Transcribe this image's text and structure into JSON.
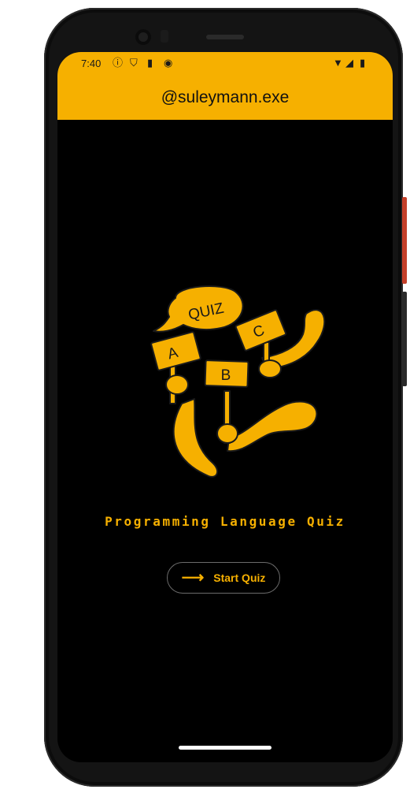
{
  "status_bar": {
    "time": "7:40",
    "left_icons": [
      "info-icon",
      "shield-icon",
      "sim-icon",
      "app-icon"
    ],
    "right_icons": [
      "wifi-icon",
      "signal-icon",
      "battery-icon"
    ]
  },
  "app_bar": {
    "title": "@suleymann.exe"
  },
  "illustration": {
    "bubble_text": "QUIZ",
    "signs": [
      "A",
      "B",
      "C"
    ]
  },
  "main": {
    "title": "Programming Language Quiz",
    "start_button": {
      "label": "Start Quiz",
      "icon": "arrow-right-icon"
    }
  },
  "colors": {
    "accent": "#f6b000",
    "background": "#000000"
  }
}
